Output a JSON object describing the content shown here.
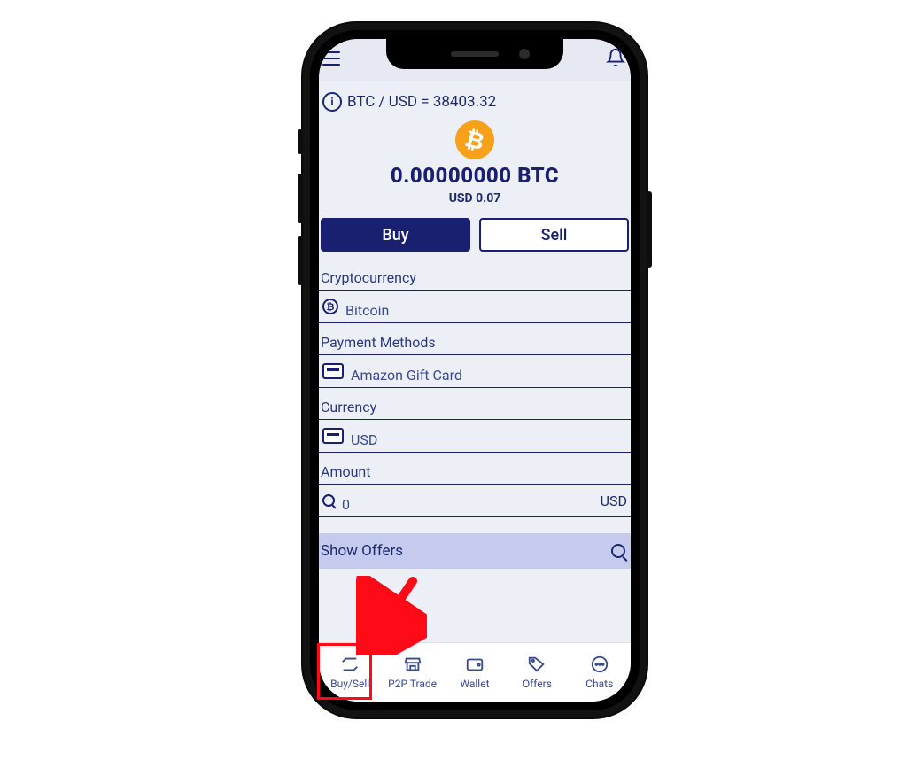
{
  "header": {
    "rate_text": "BTC / USD = 38403.32"
  },
  "balance": {
    "main": "0.00000000 BTC",
    "sub": "USD 0.07"
  },
  "buysell": {
    "buy_label": "Buy",
    "sell_label": "Sell"
  },
  "fields": {
    "crypto": {
      "label": "Cryptocurrency",
      "value": "Bitcoin"
    },
    "payment": {
      "label": "Payment Methods",
      "value": "Amazon Gift Card"
    },
    "currency": {
      "label": "Currency",
      "value": "USD"
    },
    "amount": {
      "label": "Amount",
      "value": "0",
      "suffix": "USD"
    }
  },
  "show_offers_label": "Show Offers",
  "nav": {
    "buysell": "Buy/Sell",
    "p2p": "P2P Trade",
    "wallet": "Wallet",
    "offers": "Offers",
    "chats": "Chats"
  }
}
